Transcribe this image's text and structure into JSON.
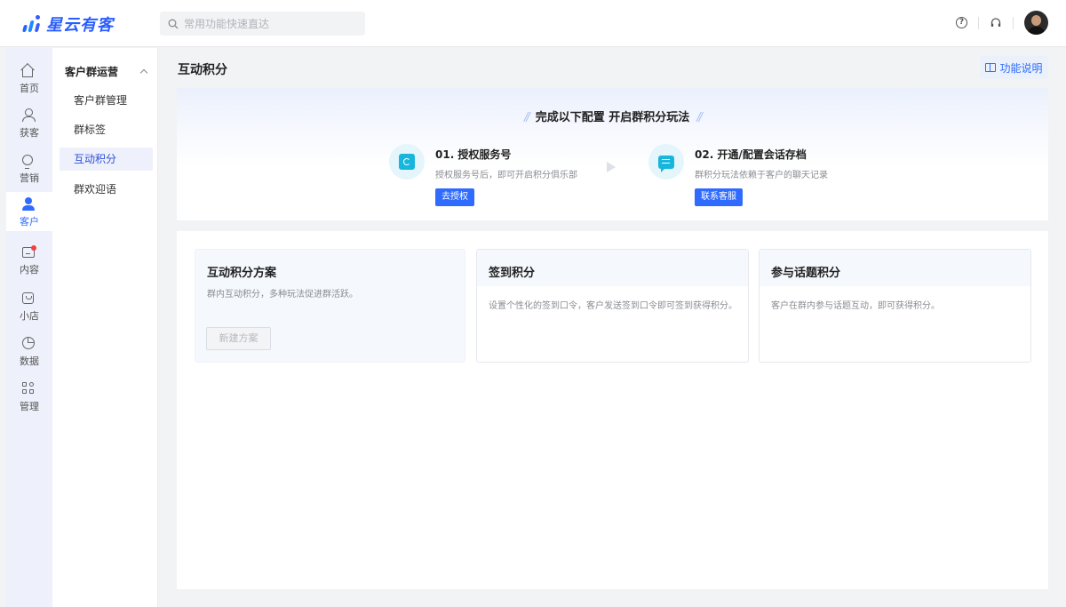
{
  "app": {
    "brand": "星云有客"
  },
  "search": {
    "placeholder": "常用功能快速直达"
  },
  "header": {
    "help_icon": "question-circle-icon",
    "service_icon": "headset-icon"
  },
  "rail": {
    "items": [
      {
        "label": "首页",
        "icon": "home-icon"
      },
      {
        "label": "获客",
        "icon": "user-plus-icon"
      },
      {
        "label": "营销",
        "icon": "bulb-icon"
      },
      {
        "label": "客户",
        "icon": "person-icon",
        "active": true
      },
      {
        "label": "内容",
        "icon": "box-icon",
        "badge": "dot"
      },
      {
        "label": "小店",
        "icon": "shop-icon"
      },
      {
        "label": "数据",
        "icon": "pie-chart-icon"
      },
      {
        "label": "管理",
        "icon": "grid-icon"
      }
    ]
  },
  "subnav": {
    "group_title": "客户群运营",
    "items": [
      {
        "label": "客户群管理"
      },
      {
        "label": "群标签"
      },
      {
        "label": "互动积分",
        "active": true
      },
      {
        "label": "群欢迎语"
      }
    ]
  },
  "main": {
    "title": "互动积分",
    "help_label": "功能说明",
    "guide": {
      "title": "完成以下配置  开启群积分玩法",
      "slash_left": "//",
      "slash_right": "//",
      "steps": [
        {
          "title": "01. 授权服务号",
          "desc": "授权服务号后，即可开启积分俱乐部",
          "button": "去授权"
        },
        {
          "title": "02. 开通/配置会话存档",
          "desc": "群积分玩法依赖于客户的聊天记录",
          "button": "联系客服"
        }
      ]
    },
    "cards": [
      {
        "title": "互动积分方案",
        "desc": "群内互动积分，多种玩法促进群活跃。",
        "button": "新建方案"
      },
      {
        "title": "签到积分",
        "desc": "设置个性化的签到口令，客户发送签到口令即可签到获得积分。"
      },
      {
        "title": "参与话题积分",
        "desc": "客户在群内参与话题互动，即可获得积分。"
      }
    ]
  }
}
